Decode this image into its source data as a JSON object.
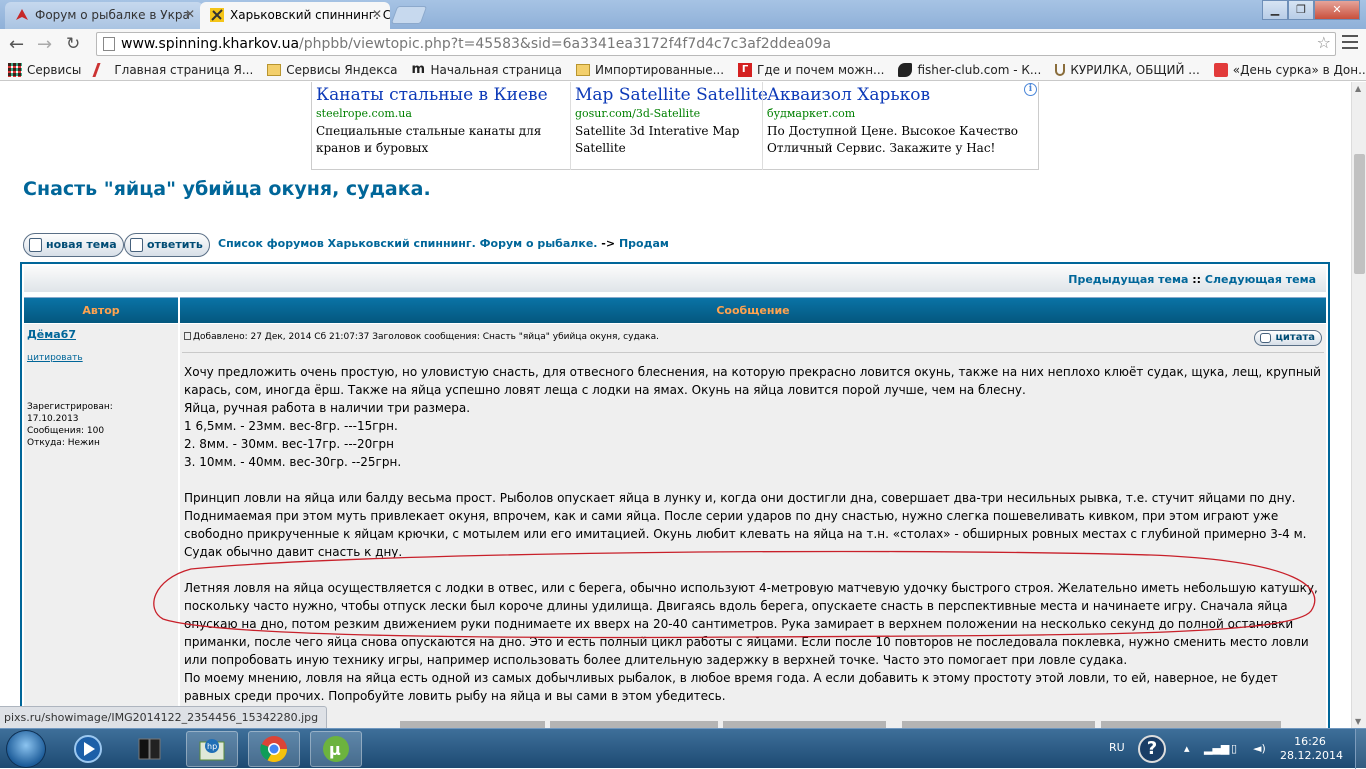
{
  "browser": {
    "tabs": [
      {
        "title": "Форум о рыбалке в Укра",
        "active": false
      },
      {
        "title": "Харьковский спиннинг. С",
        "active": true
      }
    ],
    "url_host": "www.spinning.kharkov.ua",
    "url_path": "/phpbb/viewtopic.php?t=45583&sid=6a3341ea3172f4f7d4c7c3af2ddea09a",
    "bookmarks": [
      {
        "label": "Сервисы",
        "icon": "apps-grid-icon"
      },
      {
        "label": "Главная страница Я...",
        "icon": "yandex-pen-icon"
      },
      {
        "label": "Сервисы Яндекса",
        "icon": "folder-icon"
      },
      {
        "label": "Начальная страница",
        "icon": "m-logo-icon"
      },
      {
        "label": "Импортированные...",
        "icon": "folder-icon"
      },
      {
        "label": "Где и почем можн...",
        "icon": "red-g-icon"
      },
      {
        "label": "fisher-club.com - К...",
        "icon": "fish-icon"
      },
      {
        "label": "КУРИЛКА, ОБЩИЙ ...",
        "icon": "hook-icon"
      },
      {
        "label": "«День сурка» в Дон...",
        "icon": "tsn-icon"
      }
    ]
  },
  "ads": [
    {
      "title": "Канаты стальные в Киеве",
      "url": "steelrope.com.ua",
      "desc": "Специальные стальные канаты для кранов и буровых"
    },
    {
      "title": "Map Satellite Satellite",
      "url": "gosur.com/3d-Satellite",
      "desc": "Satellite 3d Interative Map Satellite"
    },
    {
      "title": "Акваизол Харьков",
      "url": "будмаркет.com",
      "desc": "По Доступной Цене. Высокое Качество Отличный Сервис. Закажите у Нас!"
    }
  ],
  "topic": {
    "title": "Снасть \"яйца\" убийца окуня, судака.",
    "new_topic_label": "новая тема",
    "reply_label": "ответить",
    "crumb_home": "Список форумов Харьковский спиннинг. Форум о рыбалке.",
    "crumb_sep": "->",
    "crumb_forum": "Продам",
    "prev_topic": "Предыдущая тема",
    "nav_sep": "::",
    "next_topic": "Следующая тема",
    "col_author": "Автор",
    "col_message": "Сообщение"
  },
  "post": {
    "author": "Дёма67",
    "quote_link": "цитировать",
    "registered_label": "Зарегистрирован:",
    "registered_date": "17.10.2013",
    "messages": "Сообщения: 100",
    "location": "Откуда: Нежин",
    "header": "Добавлено: 27 Дек, 2014 Сб 21:07:37     Заголовок сообщения: Снасть \"яйца\" убийца окуня, судака.",
    "quote_button": "цитата",
    "paragraphs": [
      "Хочу предложить очень простую, но уловистую снасть, для отвесного блеснения, на которую прекрасно ловится окунь, также на них неплохо клюёт судак, щука, лещ, крупный карась, сом, иногда ёрш. Также на яйца успешно ловят леща с лодки на ямах. Окунь на яйца ловится порой лучше, чем на блесну.",
      "Яйца, ручная работа в наличии три размера.",
      "1 6,5мм. - 23мм. вес-8гр. ---15грн.",
      "2. 8мм. - 30мм. вес-17гр. ---20грн",
      "3. 10мм. - 40мм. вес-30гр. --25грн.",
      "Принцип ловли на яйца или балду весьма прост. Рыболов опускает яйца в лунку и, когда они достигли дна, совершает два-три несильных рывка, т.е. стучит яйцами по дну. Поднимаемая при этом муть привлекает окуня, впрочем, как и сами яйца. После серии ударов по дну снастью, нужно слегка пошевеливать кивком, при этом играют уже свободно прикрученные к яйцам крючки, с мотылем или его имитацией. Окунь любит клевать на яйца на т.н. «столах» - обширных ровных местах с глубиной примерно 3-4 м. Судак обычно давит снасть к дну.",
      "Летняя ловля на яйца осуществляется с лодки в отвес, или с берега, обычно используют 4-метровую матчевую удочку быстрого строя. Желательно иметь небольшую катушку, поскольку часто нужно, чтобы отпуск лески был короче длины удилища. Двигаясь вдоль берега, опускаете снасть в перспективные места и начинаете игру. Сначала яйца опускаю на дно, потом резким движением руки поднимаете их вверх на 20-40 сантиметров. Рука замирает в верхнем положении на несколько секунд до полной остановки приманки, после чего яйца снова опускаются на дно. Это и есть полный цикл работы с яйцами. Если после 10 повторов не последовала поклевка, нужно сменить место ловли или попробовать иную технику игры, например использовать более длительную задержку в верхней точке. Часто это помогает при ловле судака.",
      "По моему мнению, ловля на яйца есть одной из самых добычливых рыбалок, в любое время года. А если добавить к этому простоту этой ловли, то ей, наверное, не будет равных среди прочих. Попробуйте ловить рыбу на яйца и вы сами в этом убедитесь."
    ]
  },
  "status_url": "pixs.ru/showimage/IMG2014122_2354456_15342280.jpg",
  "taskbar": {
    "lang": "RU",
    "time": "16:26",
    "date": "28.12.2014"
  }
}
